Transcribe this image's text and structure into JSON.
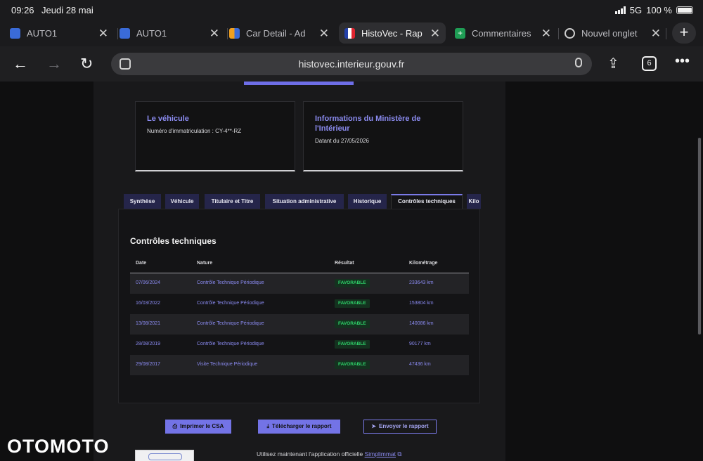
{
  "status": {
    "time": "09:26",
    "date": "Jeudi 28 mai",
    "network": "5G",
    "battery": "100 %"
  },
  "browser_tabs": [
    {
      "title": "AUTO1",
      "icon": "auto1-favicon-icon",
      "active": false
    },
    {
      "title": "AUTO1",
      "icon": "auto1-favicon-icon",
      "active": false
    },
    {
      "title": "Car Detail - Ad",
      "icon": "car-detail-favicon-icon",
      "active": false
    },
    {
      "title": "HistoVec - Rap",
      "icon": "french-republic-favicon-icon",
      "active": true
    },
    {
      "title": "Commentaires",
      "icon": "sheets-favicon-icon",
      "active": false
    },
    {
      "title": "Nouvel onglet",
      "icon": "globe-icon",
      "active": false
    }
  ],
  "toolbar": {
    "url": "histovec.interieur.gouv.fr",
    "tab_count": "6"
  },
  "cards": {
    "vehicle": {
      "title": "Le véhicule",
      "line": "Numéro d'immatriculation : CY-4**-RZ"
    },
    "ministry": {
      "title": "Informations du Ministère de l'Intérieur",
      "line": "Datant du 27/05/2026"
    }
  },
  "report_tabs": [
    "Synthèse",
    "Véhicule",
    "Titulaire et Titre",
    "Situation administrative",
    "Historique",
    "Contrôles techniques",
    "Kilo"
  ],
  "section": {
    "title": "Contrôles techniques",
    "columns": [
      "Date",
      "Nature",
      "Résultat",
      "Kilométrage"
    ],
    "rows": [
      {
        "date": "07/06/2024",
        "nature": "Contrôle Technique Périodique",
        "result": "FAVORABLE",
        "km": "233643 km"
      },
      {
        "date": "16/03/2022",
        "nature": "Contrôle Technique Périodique",
        "result": "FAVORABLE",
        "km": "153804 km"
      },
      {
        "date": "13/08/2021",
        "nature": "Contrôle Technique Périodique",
        "result": "FAVORABLE",
        "km": "140086 km"
      },
      {
        "date": "28/08/2019",
        "nature": "Contrôle Technique Périodique",
        "result": "FAVORABLE",
        "km": "90177 km"
      },
      {
        "date": "29/08/2017",
        "nature": "Visite Technique Périodique",
        "result": "FAVORABLE",
        "km": "47436 km"
      }
    ]
  },
  "actions": {
    "print": "Imprimer le CSA",
    "download": "Télécharger le rapport",
    "send": "Envoyer le rapport"
  },
  "promo": {
    "text": "Utilisez maintenant l'application officielle ",
    "link": "Simplimmat"
  },
  "watermark": "OTOMOTO",
  "colors": {
    "accent": "#7373e6",
    "link": "#8b8bf0",
    "ok_badge": "#2fd36a"
  }
}
